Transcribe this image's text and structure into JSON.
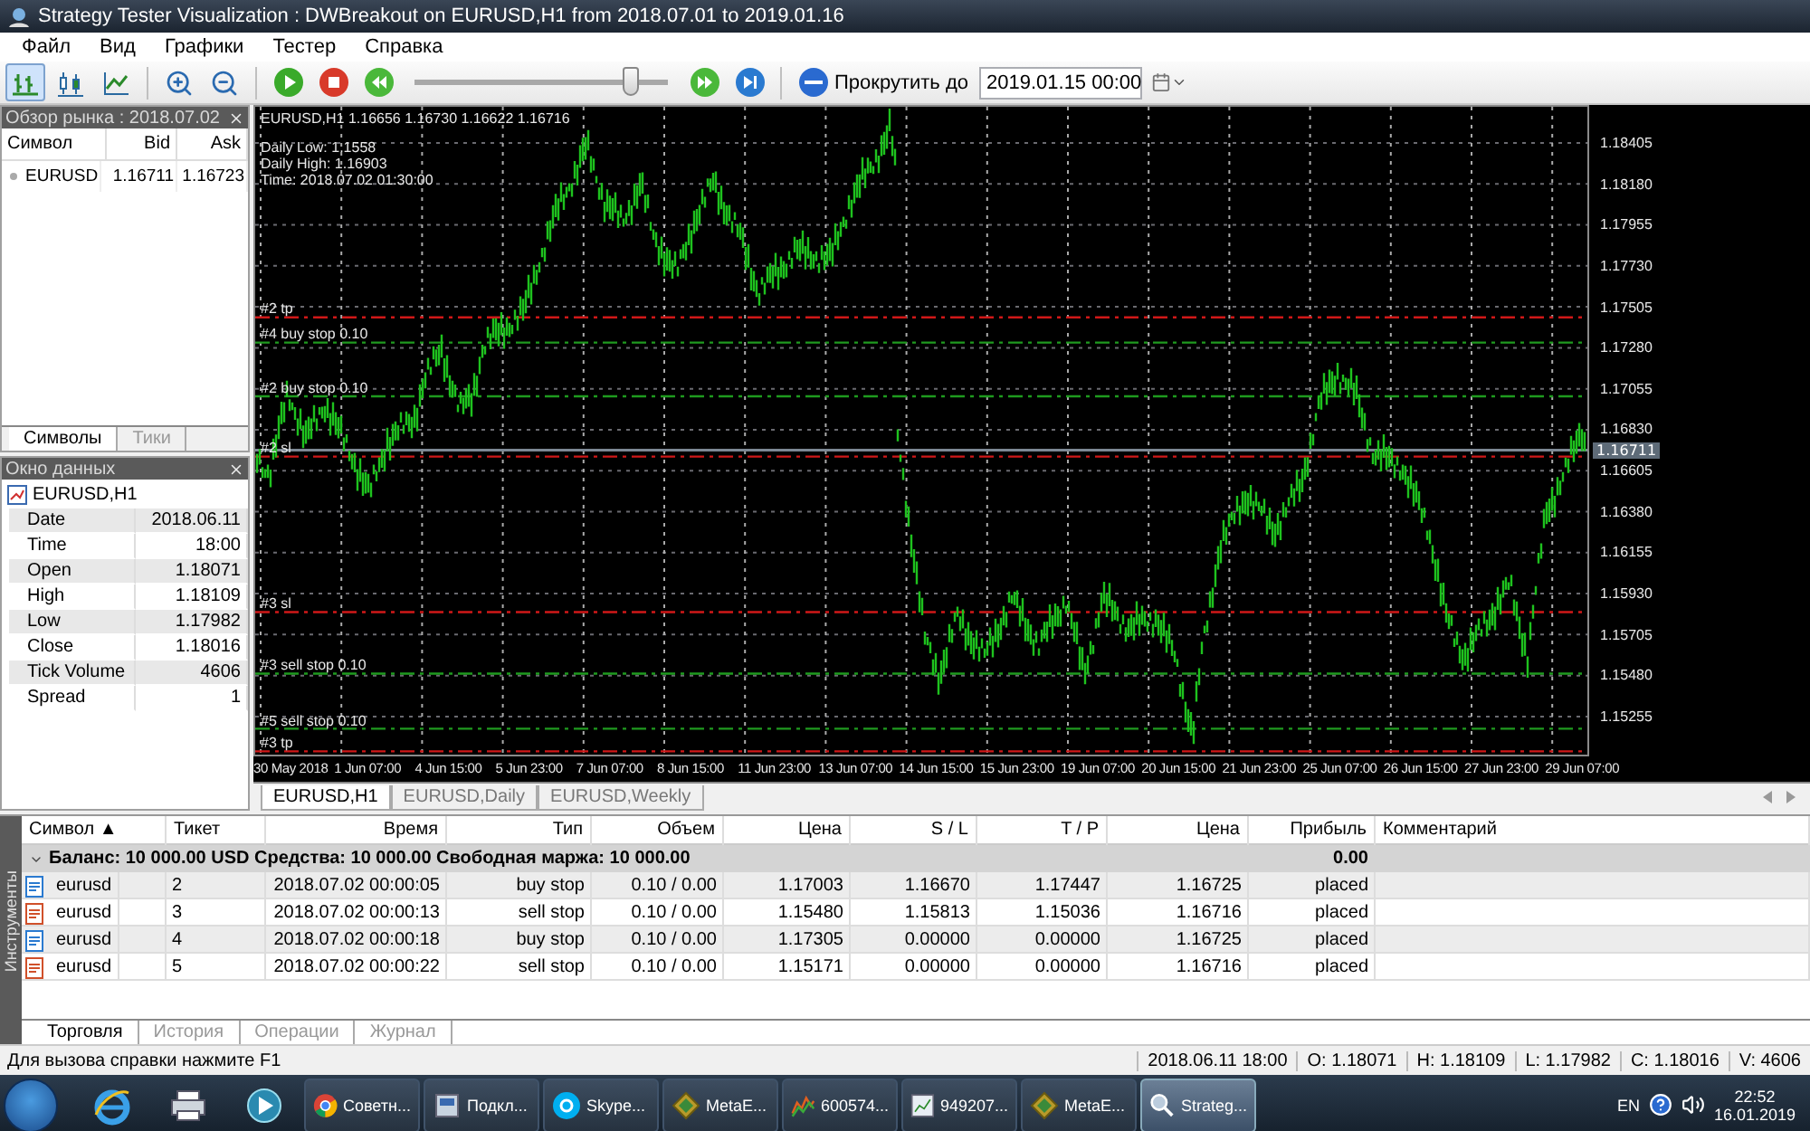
{
  "window": {
    "title": "Strategy Tester Visualization : DWBreakout on EURUSD,H1 from 2018.07.01 to 2019.01.16"
  },
  "menu": [
    "Файл",
    "Вид",
    "Графики",
    "Тестер",
    "Справка"
  ],
  "toolbar": {
    "chart_types": [
      {
        "kind": "bars",
        "selected": true
      },
      {
        "kind": "candles",
        "selected": false
      },
      {
        "kind": "line",
        "selected": false
      }
    ],
    "speed": {
      "level": 0.88
    },
    "scroll_button": "Прокрутить до",
    "scroll_date": "2019.01.15 00:00"
  },
  "market_watch": {
    "title": "Обзор рынка : 2018.07.02",
    "columns": [
      "Символ",
      "Bid",
      "Ask"
    ],
    "rows": [
      {
        "symbol": "EURUSD",
        "bid": "1.16711",
        "ask": "1.16723"
      }
    ],
    "tabs": [
      {
        "label": "Символы",
        "selected": true
      },
      {
        "label": "Тики",
        "selected": false
      }
    ]
  },
  "data_window": {
    "title": "Окно данных",
    "symbol": "EURUSD,H1",
    "rows": [
      {
        "name": "Date",
        "value": "2018.06.11"
      },
      {
        "name": "Time",
        "value": "18:00"
      },
      {
        "name": "Open",
        "value": "1.18071"
      },
      {
        "name": "High",
        "value": "1.18109"
      },
      {
        "name": "Low",
        "value": "1.17982"
      },
      {
        "name": "Close",
        "value": "1.18016"
      },
      {
        "name": "Tick Volume",
        "value": "4606"
      },
      {
        "name": "Spread",
        "value": "1"
      }
    ]
  },
  "chart": {
    "header": "EURUSD,H1  1.16656 1.16730 1.16622 1.16716",
    "info": [
      "Daily Low: 1.1558",
      "Daily High: 1.16903",
      "Time: 2018.07.02 01:30:00"
    ],
    "levels": [
      {
        "label": "#2 tp",
        "kind": "tp"
      },
      {
        "label": "#4 buy stop 0.10",
        "kind": "order"
      },
      {
        "label": "#2 buy stop 0.10",
        "kind": "order"
      },
      {
        "label": "#2 sl",
        "kind": "sl"
      },
      {
        "label": "#3 sl",
        "kind": "sl"
      },
      {
        "label": "#3 sell stop 0.10",
        "kind": "order"
      },
      {
        "label": "#5 sell stop 0.10",
        "kind": "order"
      },
      {
        "label": "#3 tp",
        "kind": "tp"
      }
    ],
    "price_axis": [
      "1.18405",
      "1.18180",
      "1.17955",
      "1.17730",
      "1.17505",
      "1.17280",
      "1.17055",
      "1.16830",
      "1.16605",
      "1.16380",
      "1.16155",
      "1.15930",
      "1.15705",
      "1.15480",
      "1.15255"
    ],
    "current_price": "1.16711",
    "time_axis": [
      "30 May 2018",
      "1 Jun 07:00",
      "4 Jun 15:00",
      "5 Jun 23:00",
      "7 Jun 07:00",
      "8 Jun 15:00",
      "11 Jun 23:00",
      "13 Jun 07:00",
      "14 Jun 15:00",
      "15 Jun 23:00",
      "19 Jun 07:00",
      "20 Jun 15:00",
      "21 Jun 23:00",
      "25 Jun 07:00",
      "26 Jun 15:00",
      "27 Jun 23:00",
      "29 Jun 07:00"
    ],
    "tabs": [
      {
        "label": "EURUSD,H1",
        "selected": true
      },
      {
        "label": "EURUSD,Daily",
        "selected": false
      },
      {
        "label": "EURUSD,Weekly",
        "selected": false
      }
    ]
  },
  "terminal": {
    "side_label": "Инструменты",
    "columns": [
      {
        "label": "Символ",
        "sort": "▲"
      },
      {
        "label": "Тикет"
      },
      {
        "label": "Время"
      },
      {
        "label": "Тип"
      },
      {
        "label": "Объем"
      },
      {
        "label": "Цена"
      },
      {
        "label": "S / L"
      },
      {
        "label": "T / P"
      },
      {
        "label": "Цена"
      },
      {
        "label": "Прибыль"
      },
      {
        "label": "Комментарий"
      }
    ],
    "summary": {
      "text": "Баланс: 10 000.00 USD  Средства: 10 000.00  Свободная маржа: 10 000.00",
      "profit": "0.00"
    },
    "rows": [
      {
        "kind": "buy",
        "cells": [
          "eurusd",
          "2",
          "2018.07.02 00:00:05",
          "buy stop",
          "0.10 / 0.00",
          "1.17003",
          "1.16670",
          "1.17447",
          "1.16725",
          "placed"
        ]
      },
      {
        "kind": "sell",
        "cells": [
          "eurusd",
          "3",
          "2018.07.02 00:00:13",
          "sell stop",
          "0.10 / 0.00",
          "1.15480",
          "1.15813",
          "1.15036",
          "1.16716",
          "placed"
        ]
      },
      {
        "kind": "buy",
        "cells": [
          "eurusd",
          "4",
          "2018.07.02 00:00:18",
          "buy stop",
          "0.10 / 0.00",
          "1.17305",
          "0.00000",
          "0.00000",
          "1.16725",
          "placed"
        ]
      },
      {
        "kind": "sell",
        "cells": [
          "eurusd",
          "5",
          "2018.07.02 00:00:22",
          "sell stop",
          "0.10 / 0.00",
          "1.15171",
          "0.00000",
          "0.00000",
          "1.16716",
          "placed"
        ]
      }
    ],
    "tabs": [
      {
        "label": "Торговля",
        "selected": true
      },
      {
        "label": "История",
        "selected": false
      },
      {
        "label": "Операции",
        "selected": false
      },
      {
        "label": "Журнал",
        "selected": false
      }
    ]
  },
  "status_bar": {
    "help": "Для вызова справки нажмите F1",
    "cells": [
      "2018.06.11 18:00",
      "O: 1.18071",
      "H: 1.18109",
      "L: 1.17982",
      "C: 1.18016",
      "V: 4606"
    ]
  },
  "taskbar": {
    "tasks": [
      {
        "kind": "chrome",
        "label": "Советн...",
        "selected": false
      },
      {
        "kind": "installer",
        "label": "Подкл...",
        "selected": false
      },
      {
        "kind": "skype",
        "label": "Skype...",
        "selected": false
      },
      {
        "kind": "meta",
        "label": "MetaE...",
        "selected": false
      },
      {
        "kind": "chart",
        "label": "600574...",
        "selected": false
      },
      {
        "kind": "doc",
        "label": "949207...",
        "selected": false
      },
      {
        "kind": "meta",
        "label": "MetaE...",
        "selected": false
      },
      {
        "kind": "tester",
        "label": "Strateg...",
        "selected": true
      }
    ],
    "language": "EN",
    "time": "22:52",
    "date": "16.01.2019"
  }
}
